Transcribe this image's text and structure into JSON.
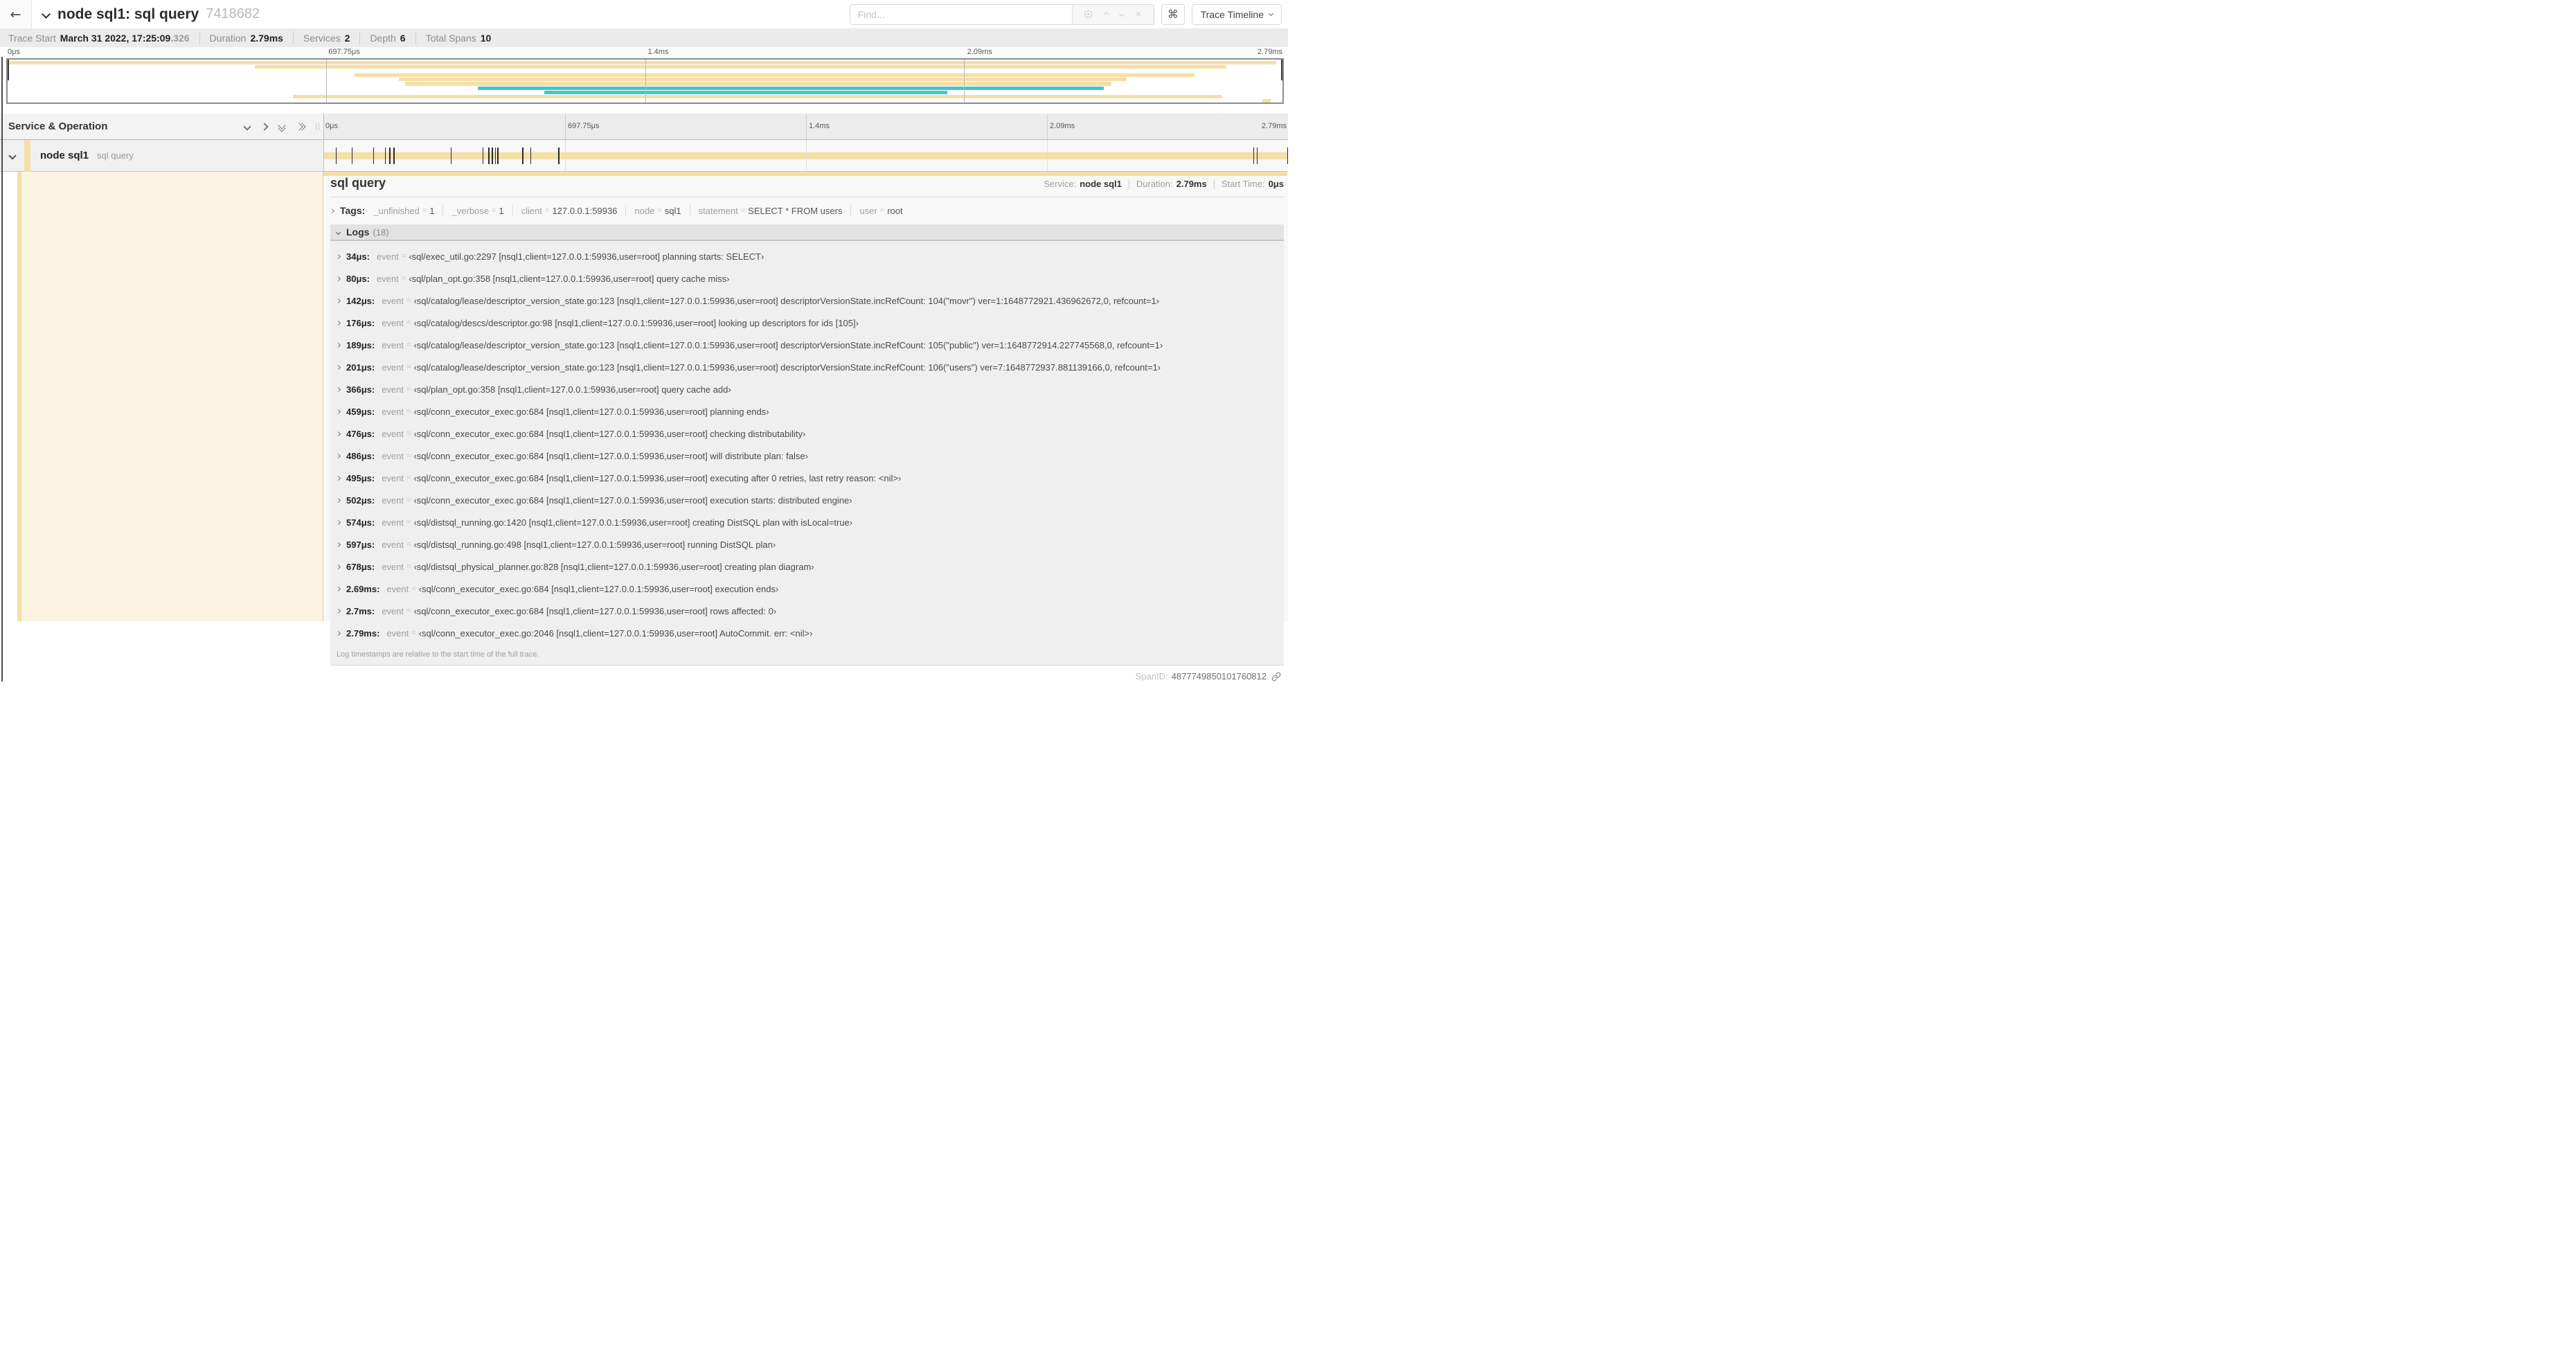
{
  "colors": {
    "tan": "#F5DFA8",
    "teal": "#45C5C9",
    "cream": "#FCF4E1"
  },
  "header": {
    "back_icon": "←",
    "title": "node sql1: sql query",
    "trace_id_short": "7418682",
    "find_placeholder": "Find...",
    "keyboard_shortcuts_icon": "⌘",
    "view_selector_label": "Trace Timeline"
  },
  "trace_info": {
    "items": [
      {
        "label": "Trace Start",
        "value": "March 31 2022, 17:25:09",
        "suffix": ".326"
      },
      {
        "label": "Duration",
        "value": "2.79ms"
      },
      {
        "label": "Services",
        "value": "2"
      },
      {
        "label": "Depth",
        "value": "6"
      },
      {
        "label": "Total Spans",
        "value": "10"
      }
    ]
  },
  "timeline": {
    "duration_us": 2790,
    "ticks": [
      "0μs",
      "697.75μs",
      "1.4ms",
      "2.09ms",
      "2.79ms"
    ],
    "tick_fractions": [
      0,
      25,
      50,
      75,
      100
    ],
    "gridline_fractions": [
      25,
      50,
      75
    ]
  },
  "minimap": {
    "spans": [
      {
        "start": 0,
        "end": 99.5,
        "color": "tan"
      },
      {
        "start": 19.4,
        "end": 95.6,
        "color": "tan"
      },
      {
        "start": 0,
        "end": 0,
        "color": "tan"
      },
      {
        "start": 27.2,
        "end": 93.1,
        "color": "tan"
      },
      {
        "start": 30.7,
        "end": 87.8,
        "color": "tan"
      },
      {
        "start": 31.2,
        "end": 86.6,
        "color": "tan"
      },
      {
        "start": 36.9,
        "end": 86.0,
        "color": "teal"
      },
      {
        "start": 42.1,
        "end": 73.7,
        "color": "teal"
      },
      {
        "start": 22.4,
        "end": 95.3,
        "color": "tan"
      },
      {
        "start": 98.4,
        "end": 99.1,
        "color": "tan"
      }
    ]
  },
  "span_table": {
    "header_title": "Service & Operation",
    "row": {
      "service": "node sql1",
      "operation": "sql query"
    }
  },
  "detail": {
    "title": "sql query",
    "summary": [
      {
        "label": "Service:",
        "value": "node sql1"
      },
      {
        "label": "Duration:",
        "value": "2.79ms"
      },
      {
        "label": "Start Time:",
        "value": "0μs"
      }
    ],
    "tags_label": "Tags:",
    "tags": [
      {
        "key": "_unfinished",
        "value": "1"
      },
      {
        "key": "_verbose",
        "value": "1"
      },
      {
        "key": "client",
        "value": "127.0.0.1:59936"
      },
      {
        "key": "node",
        "value": "sql1"
      },
      {
        "key": "statement",
        "value": "SELECT * FROM users"
      },
      {
        "key": "user",
        "value": "root"
      }
    ],
    "logs": {
      "label": "Logs",
      "count": "(18)",
      "entries": [
        {
          "time": "34μs:",
          "key": "event",
          "value": "‹sql/exec_util.go:2297 [nsql1,client=127.0.0.1:59936,user=root] planning starts: SELECT›"
        },
        {
          "time": "80μs:",
          "key": "event",
          "value": "‹sql/plan_opt.go:358 [nsql1,client=127.0.0.1:59936,user=root] query cache miss›"
        },
        {
          "time": "142μs:",
          "key": "event",
          "value": "‹sql/catalog/lease/descriptor_version_state.go:123 [nsql1,client=127.0.0.1:59936,user=root] descriptorVersionState.incRefCount: 104(\"movr\") ver=1:1648772921.436962672,0, refcount=1›"
        },
        {
          "time": "176μs:",
          "key": "event",
          "value": "‹sql/catalog/descs/descriptor.go:98 [nsql1,client=127.0.0.1:59936,user=root] looking up descriptors for ids [105]›"
        },
        {
          "time": "189μs:",
          "key": "event",
          "value": "‹sql/catalog/lease/descriptor_version_state.go:123 [nsql1,client=127.0.0.1:59936,user=root] descriptorVersionState.incRefCount: 105(\"public\") ver=1:1648772914.227745568,0, refcount=1›"
        },
        {
          "time": "201μs:",
          "key": "event",
          "value": "‹sql/catalog/lease/descriptor_version_state.go:123 [nsql1,client=127.0.0.1:59936,user=root] descriptorVersionState.incRefCount: 106(\"users\") ver=7:1648772937.881139166,0, refcount=1›"
        },
        {
          "time": "366μs:",
          "key": "event",
          "value": "‹sql/plan_opt.go:358 [nsql1,client=127.0.0.1:59936,user=root] query cache add›"
        },
        {
          "time": "459μs:",
          "key": "event",
          "value": "‹sql/conn_executor_exec.go:684 [nsql1,client=127.0.0.1:59936,user=root] planning ends›"
        },
        {
          "time": "476μs:",
          "key": "event",
          "value": "‹sql/conn_executor_exec.go:684 [nsql1,client=127.0.0.1:59936,user=root] checking distributability›"
        },
        {
          "time": "486μs:",
          "key": "event",
          "value": "‹sql/conn_executor_exec.go:684 [nsql1,client=127.0.0.1:59936,user=root] will distribute plan: false›"
        },
        {
          "time": "495μs:",
          "key": "event",
          "value": "‹sql/conn_executor_exec.go:684 [nsql1,client=127.0.0.1:59936,user=root] executing after 0 retries, last retry reason: <nil>›"
        },
        {
          "time": "502μs:",
          "key": "event",
          "value": "‹sql/conn_executor_exec.go:684 [nsql1,client=127.0.0.1:59936,user=root] execution starts: distributed engine›"
        },
        {
          "time": "574μs:",
          "key": "event",
          "value": "‹sql/distsql_running.go:1420 [nsql1,client=127.0.0.1:59936,user=root] creating DistSQL plan with isLocal=true›"
        },
        {
          "time": "597μs:",
          "key": "event",
          "value": "‹sql/distsql_running.go:498 [nsql1,client=127.0.0.1:59936,user=root] running DistSQL plan›"
        },
        {
          "time": "678μs:",
          "key": "event",
          "value": "‹sql/distsql_physical_planner.go:828 [nsql1,client=127.0.0.1:59936,user=root] creating plan diagram›"
        },
        {
          "time": "2.69ms:",
          "key": "event",
          "value": "‹sql/conn_executor_exec.go:684 [nsql1,client=127.0.0.1:59936,user=root] execution ends›"
        },
        {
          "time": "2.7ms:",
          "key": "event",
          "value": "‹sql/conn_executor_exec.go:684 [nsql1,client=127.0.0.1:59936,user=root] rows affected: 0›"
        },
        {
          "time": "2.79ms:",
          "key": "event",
          "value": "‹sql/conn_executor_exec.go:2046 [nsql1,client=127.0.0.1:59936,user=root] AutoCommit. err: <nil>›"
        }
      ],
      "footer": "Log timestamps are relative to the start time of the full trace."
    },
    "span_id_label": "SpanID:",
    "span_id": "4877749850101760812"
  }
}
